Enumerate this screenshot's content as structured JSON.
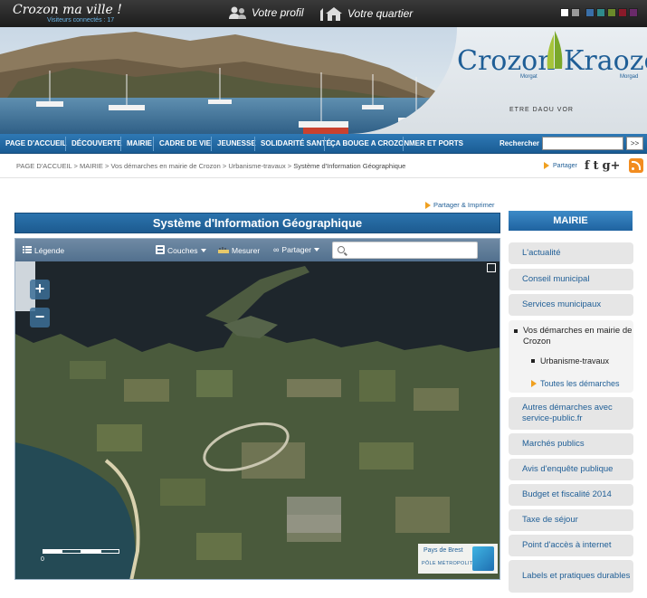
{
  "topbar": {
    "site_title": "Crozon ma ville !",
    "visitors": "Visiteurs connectés : 17",
    "profile_label": "Votre profil",
    "quartier_label": "Votre quartier",
    "colors": [
      "#ffffff",
      "#9a9a9a",
      "#3a6fa8",
      "#2f8a8a",
      "#6a8a2a",
      "#8a1a2a",
      "#6a2a6a"
    ]
  },
  "header": {
    "logo_left": "Crozon",
    "logo_right": "Kraozon",
    "logo_tag_left": "Morgat",
    "logo_tag_right": "Morgad",
    "logo_subtitle": "ETRE DAOU VOR"
  },
  "nav": {
    "items": [
      "PAGE D'ACCUEIL",
      "DÉCOUVERTE",
      "MAIRIE",
      "CADRE DE VIE",
      "JEUNESSE",
      "SOLIDARITÉ SANTÉ",
      "ÇA BOUGE A CROZON",
      "MER ET PORTS"
    ],
    "search_label": "Rechercher :",
    "search_value": "",
    "search_button": ">>"
  },
  "breadcrumb": {
    "items": [
      "PAGE D'ACCUEIL",
      "MAIRIE",
      "Vos démarches en mairie de Crozon",
      "Urbanisme-travaux"
    ],
    "separator": ">",
    "current": "Système d'Information Géographique"
  },
  "share": {
    "label": "Partager",
    "facebook": "f",
    "twitter": "t",
    "gplus": "g+"
  },
  "main": {
    "print_link": "Partager & Imprimer",
    "title": "Système d'Information Géographique"
  },
  "map": {
    "toolbar": {
      "legend": "Légende",
      "layers": "Couches",
      "measure": "Mesurer",
      "share": "Partager",
      "search_placeholder": ""
    },
    "zoom_in": "+",
    "zoom_out": "−",
    "scale_zero": "0",
    "partner_line1": "Pays de Brest",
    "partner_line2": "PÔLE MÉTROPOLITAIN"
  },
  "sidebar": {
    "header": "MAIRIE",
    "items": [
      {
        "label": "L'actualité"
      },
      {
        "label": "Conseil municipal"
      },
      {
        "label": "Services municipaux"
      },
      {
        "label": "Vos démarches en mairie de Crozon"
      },
      {
        "label": "Urbanisme-travaux"
      },
      {
        "label": "Toutes les démarches"
      },
      {
        "label": "Autres démarches avec service-public.fr"
      },
      {
        "label": "Marchés publics"
      },
      {
        "label": "Avis d'enquête publique"
      },
      {
        "label": "Budget et fiscalité 2014"
      },
      {
        "label": "Taxe de séjour"
      },
      {
        "label": "Point d'accès à internet"
      },
      {
        "label": "Labels et pratiques durables"
      }
    ]
  }
}
